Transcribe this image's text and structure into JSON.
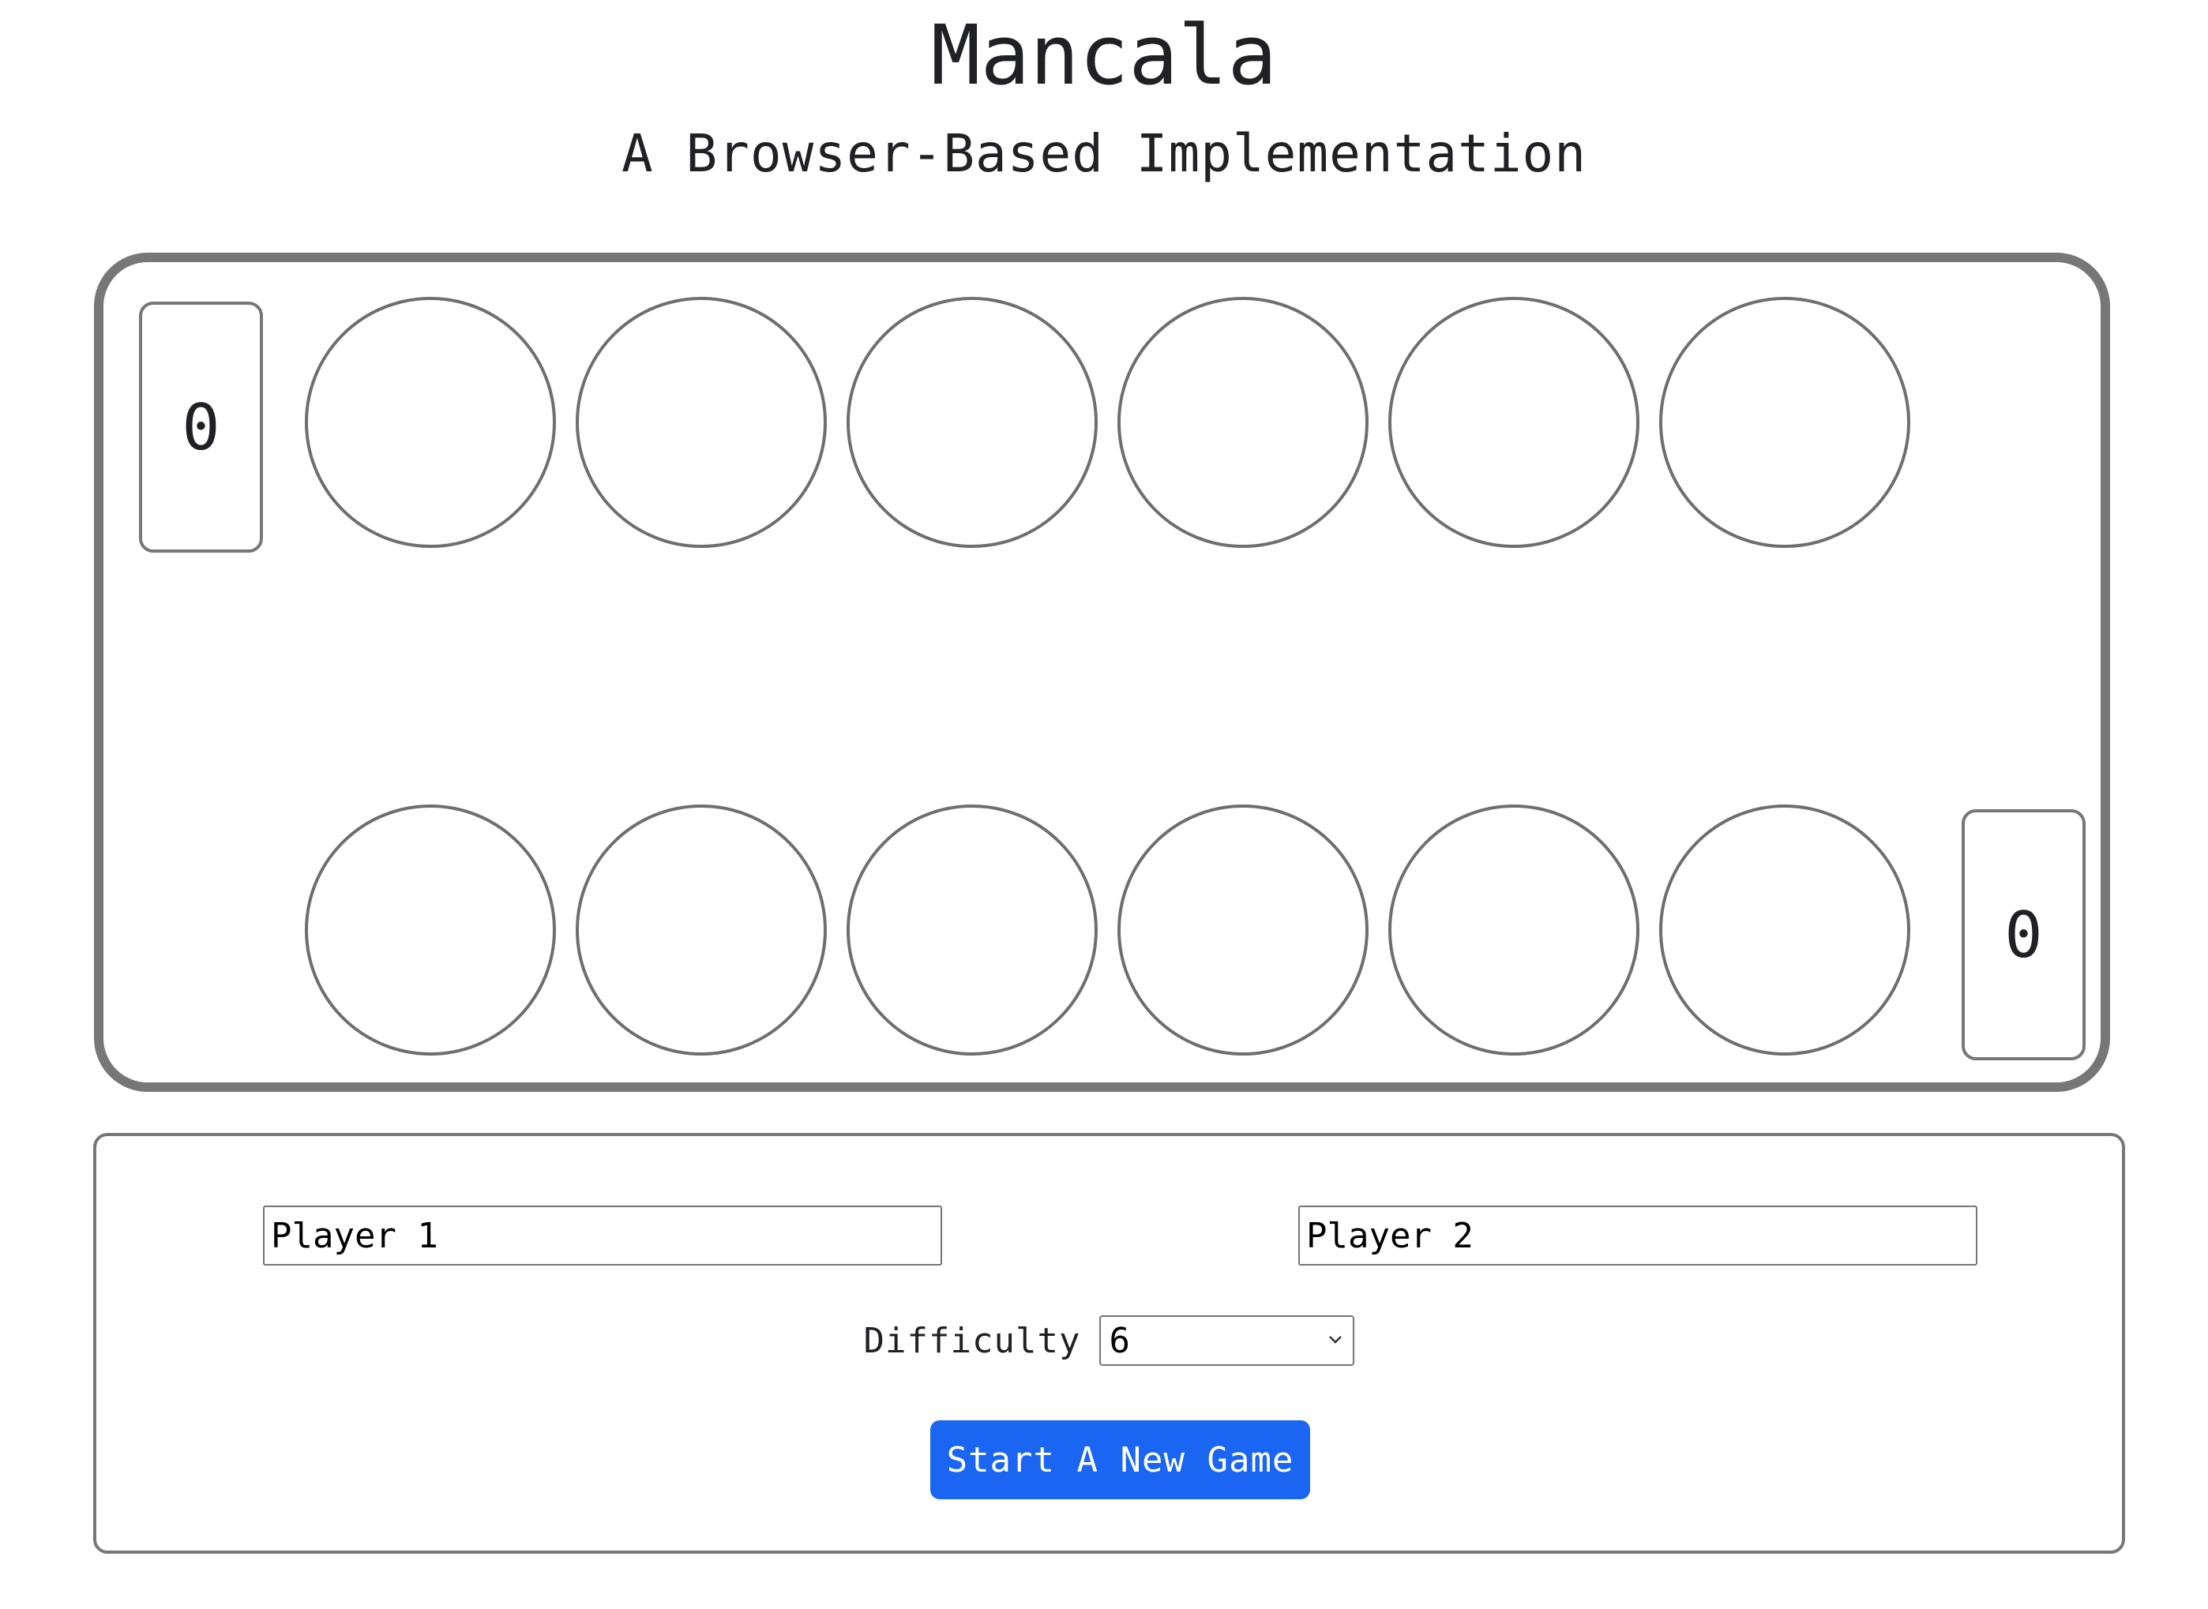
{
  "header": {
    "title": "Mancala",
    "subtitle": "A Browser-Based Implementation"
  },
  "board": {
    "left_store": "0",
    "right_store": "0",
    "top_pits": [
      "",
      "",
      "",
      "",
      "",
      ""
    ],
    "bottom_pits": [
      "",
      "",
      "",
      "",
      "",
      ""
    ]
  },
  "controls": {
    "player1_value": "Player 1",
    "player2_value": "Player 2",
    "difficulty_label": "Difficulty",
    "difficulty_value": "6",
    "start_label": "Start A New Game"
  },
  "colors": {
    "accent": "#1a66f2",
    "border": "#777777"
  }
}
